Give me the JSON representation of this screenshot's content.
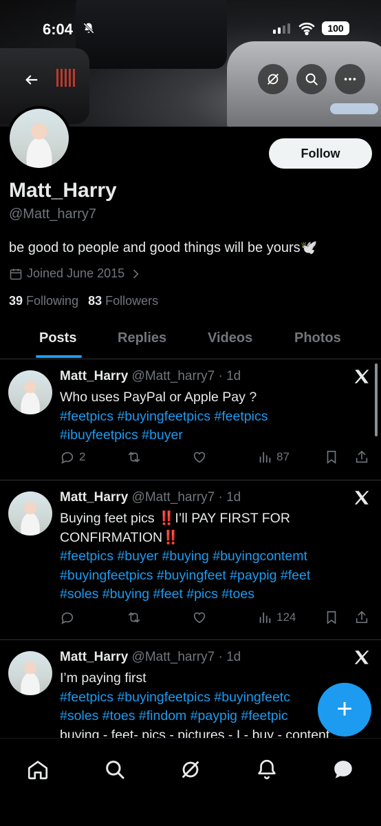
{
  "status_bar": {
    "time": "6:04",
    "battery": "100"
  },
  "profile": {
    "follow_label": "Follow",
    "name": "Matt_Harry",
    "handle": "@Matt_harry7",
    "bio": "be good to people and good things will be yours🕊️",
    "joined": "Joined June 2015",
    "following_count": "39",
    "following_label": "Following",
    "followers_count": "83",
    "followers_label": "Followers"
  },
  "tabs": [
    {
      "label": "Posts",
      "active": true
    },
    {
      "label": "Replies",
      "active": false
    },
    {
      "label": "Videos",
      "active": false
    },
    {
      "label": "Photos",
      "active": false
    }
  ],
  "posts": [
    {
      "name": "Matt_Harry",
      "meta": "@Matt_harry7 · 1d",
      "line1": "Who uses PayPal or Apple Pay ?",
      "tags1": "#feetpics #buyingfeetpics #feetpics",
      "tags2": "#ibuyfeetpics #buyer",
      "replies": "2",
      "views": "87"
    },
    {
      "name": "Matt_Harry",
      "meta": "@Matt_harry7 · 1d",
      "line1": "Buying feet pics ‼️I’ll PAY FIRST FOR",
      "line2": "CONFIRMATION‼️",
      "tags1": "#feetpics #buyer #buying #buyingcontemt",
      "tags2": "#buyingfeetpics #buyingfeet #paypig #feet",
      "tags3": "#soles #buying #feet #pics #toes",
      "views": "124"
    },
    {
      "name": "Matt_Harry",
      "meta": "@Matt_harry7 · 1d",
      "line1": "I’m paying first",
      "tags1": "#feetpics #buyingfeetpics #buyingfeetc",
      "tags2": "#soles #toes #findom #paypig #feetpic",
      "line3": "buying - feet- pics - pictures - I - buy - content"
    }
  ],
  "colors": {
    "accent": "#1d9bf0",
    "muted": "#71767b",
    "text": "#e7e9ea",
    "background": "#000000"
  },
  "icons": [
    "back-arrow-icon",
    "grok-icon",
    "search-icon",
    "more-icon",
    "calendar-icon",
    "x-logo-icon",
    "reply-icon",
    "repost-icon",
    "like-icon",
    "views-icon",
    "bookmark-icon",
    "share-icon",
    "compose-plus-icon",
    "home-icon",
    "notifications-icon",
    "messages-icon"
  ]
}
